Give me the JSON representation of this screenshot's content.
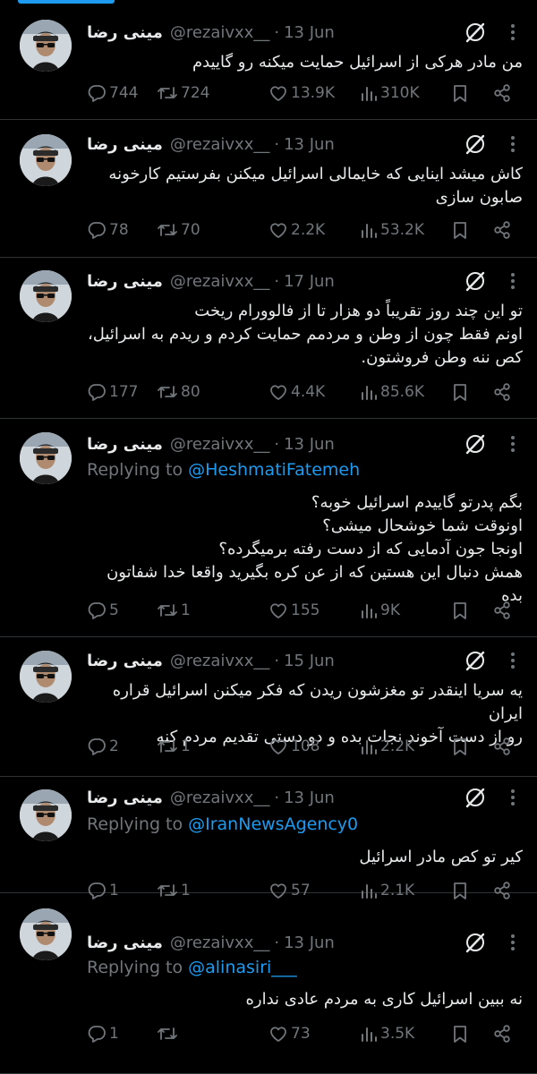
{
  "author": {
    "name": "مینی رضا",
    "handle": "@rezaivxx__"
  },
  "colors": {
    "background": "#000000",
    "accent": "#1d9bf0",
    "muted": "#71767b",
    "text": "#e7e9ea"
  },
  "icons": {
    "grok": "grok-icon",
    "more": "more-icon",
    "reply": "reply-icon",
    "retweet": "retweet-icon",
    "like": "heart-icon",
    "views": "views-icon",
    "bookmark": "bookmark-icon",
    "share": "share-icon"
  },
  "tweets": [
    {
      "date": "13 Jun",
      "replying_to": "",
      "lines": [
        "من مادر هرکی از اسرائیل حمایت میکنه رو گاییدم"
      ],
      "replies": "744",
      "retweets": "724",
      "likes": "13.9K",
      "views": "310K"
    },
    {
      "date": "13 Jun",
      "replying_to": "",
      "lines": [
        "کاش میشد اینایی که خایمالی اسرائیل میکنن بفرستیم کارخونه",
        "صابون سازی"
      ],
      "replies": "78",
      "retweets": "70",
      "likes": "2.2K",
      "views": "53.2K"
    },
    {
      "date": "17 Jun",
      "replying_to": "",
      "lines": [
        "تو این چند روز تقریباً دو هزار تا از فالوورام ریخت",
        "اونم فقط چون از وطن و مردمم حمایت کردم و ریدم به اسرائیل،",
        "کص ننه وطن فروشتون."
      ],
      "replies": "177",
      "retweets": "80",
      "likes": "4.4K",
      "views": "85.6K"
    },
    {
      "date": "13 Jun",
      "replying_to": "@HeshmatiFatemeh",
      "lines": [
        "بگم پدرتو گاییدم اسرائیل خوبه؟",
        "اونوقت شما خوشحال میشی؟",
        "اونجا جون آدمایی که از دست رفته برمیگرده؟",
        "همش دنبال این هستین که از عن کره بگیرید واقعا خدا شفاتون بده"
      ],
      "replies": "5",
      "retweets": "1",
      "likes": "155",
      "views": "9K"
    },
    {
      "date": "15 Jun",
      "replying_to": "",
      "lines": [
        "یه سریا اینقدر تو مغزشون ریدن که فکر میکنن اسرائیل قراره ایران",
        "رو از دست آخوند نجات بده و دو دستی تقدیم مردم کنه"
      ],
      "replies": "2",
      "retweets": "1",
      "likes": "108",
      "views": "2.2K"
    },
    {
      "date": "13 Jun",
      "replying_to": "@IranNewsAgency0",
      "lines": [
        "کیر تو کص مادر اسرائیل"
      ],
      "replies": "1",
      "retweets": "1",
      "likes": "57",
      "views": "2.1K"
    },
    {
      "date": "13 Jun",
      "replying_to": "@alinasiri___",
      "lines": [
        "نه ببین اسرائیل کاری به مردم عادی نداره"
      ],
      "replies": "1",
      "retweets": "",
      "likes": "73",
      "views": "3.5K"
    }
  ],
  "reply_label": "Replying to",
  "dot": "·"
}
